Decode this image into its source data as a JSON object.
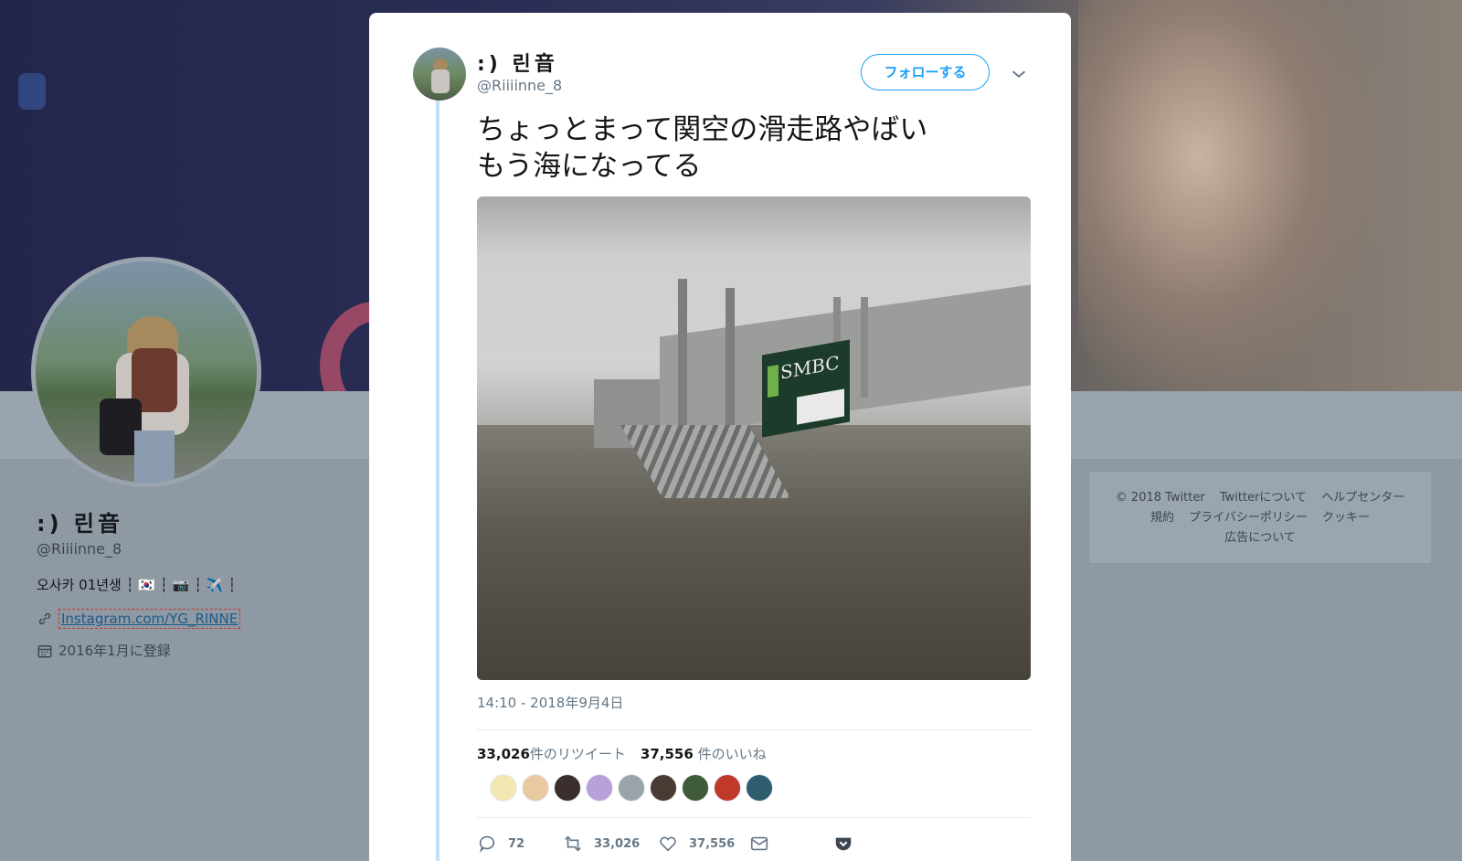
{
  "profile": {
    "name": ":) 린音",
    "handle": "@Riiiinne_8",
    "bio": "오사카 01년생 ┆ 🇰🇷 ┆ 📷 ┆ ✈️ ┆",
    "link_text": "Instagram.com/YG_RINNE",
    "joined": "2016年1月に登録"
  },
  "footer": {
    "items": [
      "© 2018 Twitter",
      "Twitterについて",
      "ヘルプセンター",
      "規約",
      "プライバシーポリシー",
      "クッキー",
      "広告について"
    ]
  },
  "tweet": {
    "author_name": ":) 린音",
    "author_handle": "@Riiiinne_8",
    "follow_label": "フォローする",
    "text_line1": "ちょっとまって関空の滑走路やばい",
    "text_line2": "もう海になってる",
    "photo_sign_text": "SMBC",
    "timestamp": "14:10 - 2018年9月4日",
    "retweet_count": "33,026",
    "retweet_label": "件のリツイート",
    "like_count": "37,556",
    "like_label": "件のいいね",
    "actions": {
      "reply_count": "72",
      "retweet_count": "33,026",
      "like_count": "37,556"
    },
    "liker_colors": [
      "#f3e7b2",
      "#e8c9a0",
      "#3a2f2c",
      "#b9a0d8",
      "#9aa3a8",
      "#4a3a34",
      "#3f5b3a",
      "#c0392b",
      "#2f5d6e"
    ]
  },
  "icons": {
    "link": "link-icon",
    "calendar": "calendar-icon",
    "caret": "chevron-down-icon",
    "reply": "reply-icon",
    "retweet": "retweet-icon",
    "like": "heart-icon",
    "dm": "envelope-icon",
    "pocket": "pocket-icon"
  },
  "colors": {
    "accent": "#1da1f2",
    "muted": "#657786",
    "pocket": "#3c4650"
  }
}
